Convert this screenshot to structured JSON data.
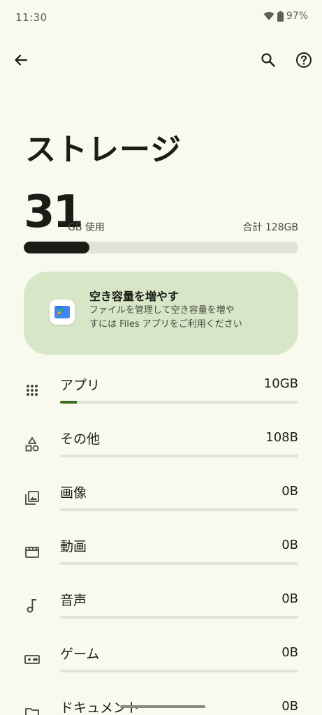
{
  "status_bar": {
    "time": "11:30",
    "battery": "97%"
  },
  "header": {
    "title": "ストレージ"
  },
  "usage": {
    "used_value": "31",
    "used_unit": "GB 使用",
    "total": "合計 128GB",
    "used_fraction": 0.24
  },
  "promo": {
    "title": "空き容量を増やす",
    "body": "ファイルを管理して空き容量を増やすには Files アプリをご利用ください"
  },
  "categories": [
    {
      "label": "アプリ",
      "size": "10GB",
      "fraction": 0.07,
      "icon": "apps-grid-icon"
    },
    {
      "label": "その他",
      "size": "108B",
      "fraction": 0.0,
      "icon": "shapes-icon"
    },
    {
      "label": "画像",
      "size": "0B",
      "fraction": 0.0,
      "icon": "image-icon"
    },
    {
      "label": "動画",
      "size": "0B",
      "fraction": 0.0,
      "icon": "video-icon"
    },
    {
      "label": "音声",
      "size": "0B",
      "fraction": 0.0,
      "icon": "music-note-icon"
    },
    {
      "label": "ゲーム",
      "size": "0B",
      "fraction": 0.0,
      "icon": "gamepad-icon"
    },
    {
      "label": "ドキュメント",
      "size": "0B",
      "fraction": 0.0,
      "icon": "folder-icon"
    }
  ],
  "colors": {
    "accent": "#3d6b1f",
    "card": "#d7e6c7",
    "track": "#e2e3d8",
    "background": "#f9faef"
  }
}
